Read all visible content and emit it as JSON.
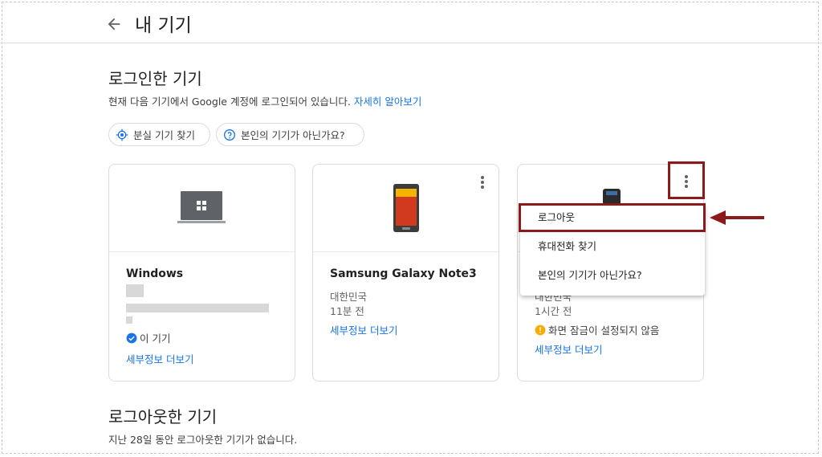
{
  "header": {
    "title": "내 기기"
  },
  "signed_in": {
    "title": "로그인한 기기",
    "description": "현재 다음 기기에서 Google 계정에 로그인되어 있습니다.",
    "learn_more": "자세히 알아보기",
    "chips": [
      {
        "label": "분실 기기 찾기",
        "icon": "locate-icon"
      },
      {
        "label": "본인의 기기가 아닌가요?",
        "icon": "help-icon"
      }
    ]
  },
  "devices": [
    {
      "name": "Windows",
      "status": "이 기기",
      "details_link": "세부정보 더보기"
    },
    {
      "name": "Samsung Galaxy Note3",
      "location": "대한민국",
      "time": "11분 전",
      "details_link": "세부정보 더보기"
    },
    {
      "location": "대한민국",
      "time": "1시간 전",
      "warning": "화면 잠금이 설정되지 않음",
      "details_link": "세부정보 더보기"
    }
  ],
  "menu": {
    "items": [
      "로그아웃",
      "휴대전화 찾기",
      "본인의 기기가 아닌가요?"
    ]
  },
  "signed_out": {
    "title": "로그아웃한 기기",
    "description": "지난 28일 동안 로그아웃한 기기가 없습니다."
  },
  "colors": {
    "accent": "#1a73e8",
    "annotation": "#8b1a1a",
    "warning": "#f9ab00"
  }
}
